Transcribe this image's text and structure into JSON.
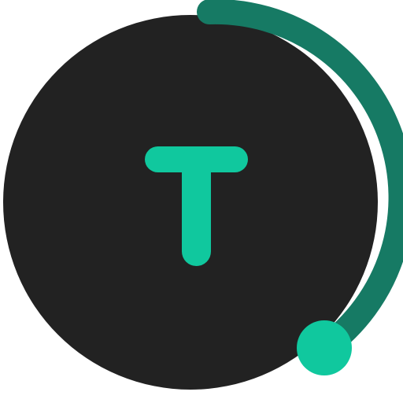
{
  "logo": {
    "name": "t-logo",
    "letter": "T",
    "progress_arc": 0.36,
    "colors": {
      "background": "#ffffff",
      "disc": "#222222",
      "accent": "#10c89e",
      "arc": "#167a64"
    },
    "icons": {
      "letter_glyph": "letter-t-icon",
      "arc": "progress-arc-icon",
      "knob": "knob-dot-icon"
    }
  }
}
